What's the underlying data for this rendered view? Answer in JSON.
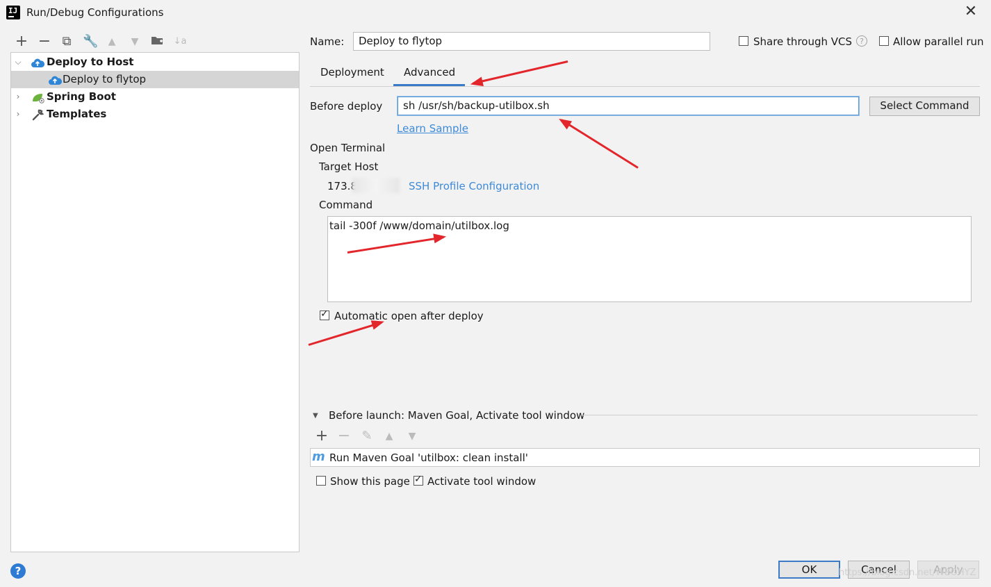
{
  "window": {
    "title": "Run/Debug Configurations",
    "close_icon": "close-icon"
  },
  "toolbar": {
    "icons": [
      "add-icon",
      "remove-icon",
      "copy-icon",
      "wrench-icon",
      "move-up-icon",
      "move-down-icon",
      "folder-add-icon",
      "sort-icon"
    ]
  },
  "tree": {
    "items": [
      {
        "label": "Deploy to Host",
        "bold": true,
        "expanded": true,
        "icon": "cloud-upload-icon"
      },
      {
        "label": "Deploy to flytop",
        "selected": true,
        "icon": "cloud-upload-icon"
      },
      {
        "label": "Spring Boot",
        "bold": true,
        "expanded": false,
        "icon": "spring-icon"
      },
      {
        "label": "Templates",
        "bold": true,
        "expanded": false,
        "icon": "wrench-icon"
      }
    ]
  },
  "form": {
    "name_label": "Name:",
    "name_value": "Deploy to flytop",
    "share_vcs_label": "Share through VCS",
    "allow_parallel_label": "Allow parallel run",
    "tabs": [
      {
        "label": "Deployment",
        "active": false
      },
      {
        "label": "Advanced",
        "active": true
      }
    ],
    "before_deploy_label": "Before deploy",
    "before_deploy_value": "sh /usr/sh/backup-utilbox.sh",
    "select_command_label": "Select Command",
    "learn_sample_link": "Learn Sample",
    "open_terminal_label": "Open Terminal",
    "target_host_label": "Target Host",
    "target_host_value": "173.8",
    "ssh_profile_link": "SSH Profile Configuration",
    "command_label": "Command",
    "command_value": "tail -300f /www/domain/utilbox.log",
    "auto_open_label": "Automatic open after deploy",
    "auto_open_checked": true
  },
  "before_launch": {
    "header": "Before launch: Maven Goal, Activate tool window",
    "task": "Run Maven Goal 'utilbox: clean install'",
    "show_page_label": "Show this page",
    "show_page_checked": false,
    "activate_tool_window_label": "Activate tool window",
    "activate_tool_window_checked": true
  },
  "footer": {
    "ok_label": "OK",
    "cancel_label": "Cancel",
    "apply_label": "Apply",
    "watermark": "https://blog.csdn.net/WBOHYZ"
  },
  "colors": {
    "accent": "#3b7ac6",
    "link": "#3d8ad8",
    "annotation_arrow": "#e3262b"
  }
}
